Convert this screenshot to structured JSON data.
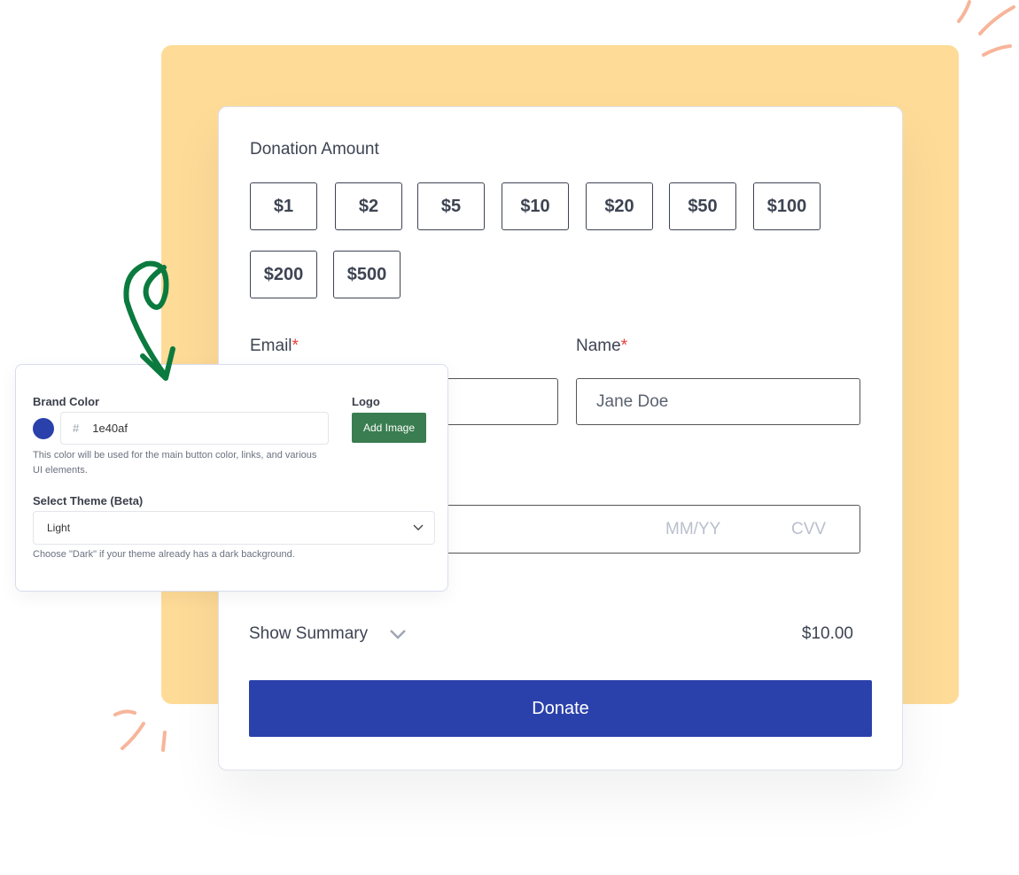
{
  "donation": {
    "title": "Donation Amount",
    "amounts": [
      "$1",
      "$2",
      "$5",
      "$10",
      "$20",
      "$50",
      "$100",
      "$200",
      "$500"
    ]
  },
  "fields": {
    "email_label": "Email",
    "name_label": "Name",
    "required_mark": "*",
    "name_value": "Jane Doe",
    "expiry_placeholder": "MM/YY",
    "cvv_placeholder": "CVV"
  },
  "summary": {
    "label": "Show Summary",
    "total": "$10.00"
  },
  "donate_label": "Donate",
  "settings": {
    "brand_color_label": "Brand Color",
    "hash": "#",
    "brand_color_value": "1e40af",
    "brand_color_help": "This color will be used for the main button color, links, and various UI elements.",
    "logo_label": "Logo",
    "add_image_label": "Add Image",
    "theme_label": "Select Theme (Beta)",
    "theme_value": "Light",
    "theme_help": "Choose \"Dark\" if your theme already has a dark background."
  },
  "colors": {
    "brand": "#2a40ab",
    "swatch": "#1e40af",
    "accent_bg": "#fedb97",
    "add_image": "#3a7d50",
    "arrow": "#0b7a3e",
    "doodle": "#f7b59a"
  },
  "icons": {
    "summary_toggle": "chevron-down-icon",
    "theme_select": "chevron-down-icon",
    "arrow": "hand-drawn-arrow-icon"
  }
}
